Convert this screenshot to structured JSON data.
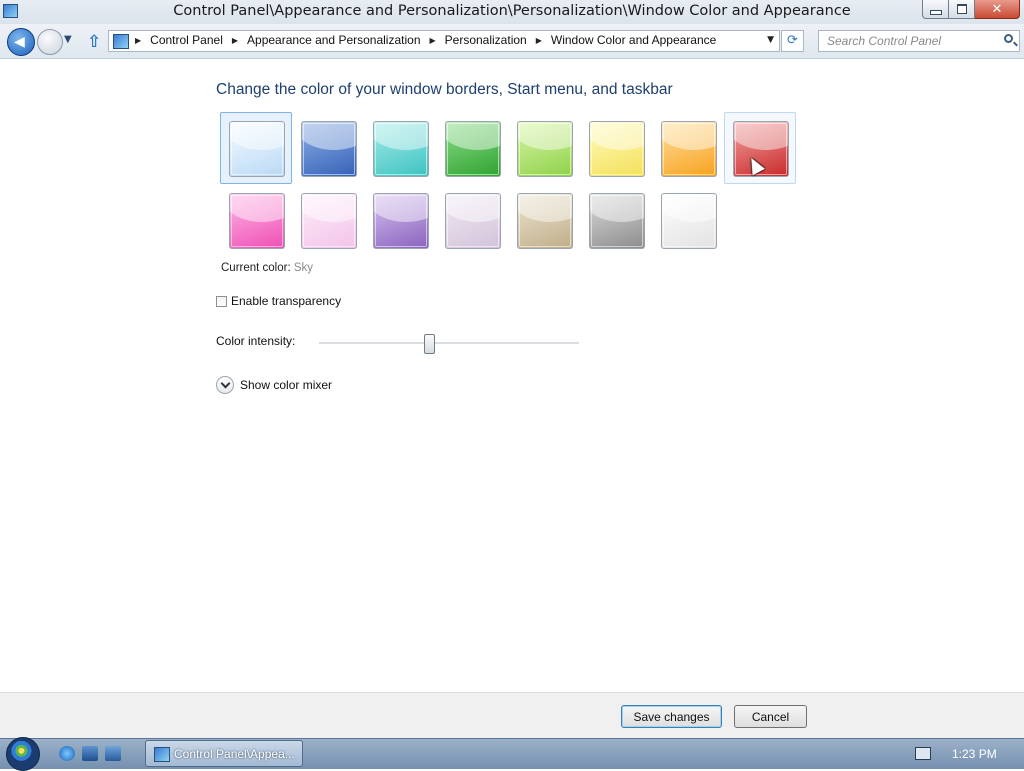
{
  "window": {
    "title": "Control Panel\\Appearance and Personalization\\Personalization\\Window Color and Appearance",
    "controls": {
      "minimize": "minimize",
      "maximize": "restore",
      "close": "close"
    }
  },
  "nav": {
    "breadcrumbs": [
      "Control Panel",
      "Appearance and Personalization",
      "Personalization",
      "Window Color and Appearance"
    ],
    "search_placeholder": "Search Control Panel"
  },
  "content": {
    "heading": "Change the color of your window borders, Start menu, and taskbar",
    "swatches": [
      {
        "name": "sky",
        "colors": [
          "#f6fbff",
          "#b9d9f5"
        ]
      },
      {
        "name": "twilight",
        "colors": [
          "#8fb0e6",
          "#3562b8"
        ]
      },
      {
        "name": "sea",
        "colors": [
          "#a7ece8",
          "#3ec3c2"
        ]
      },
      {
        "name": "leaf",
        "colors": [
          "#8fdc8a",
          "#2ea331"
        ]
      },
      {
        "name": "lime",
        "colors": [
          "#d9f5a6",
          "#8fd24a"
        ]
      },
      {
        "name": "sun",
        "colors": [
          "#fffbbd",
          "#f4e05a"
        ]
      },
      {
        "name": "pumpkin",
        "colors": [
          "#ffe0a0",
          "#f7a21e"
        ]
      },
      {
        "name": "ruby",
        "colors": [
          "#f2a3a3",
          "#c92a2a"
        ]
      },
      {
        "name": "fuchsia",
        "colors": [
          "#ffb8e6",
          "#ee4fb4"
        ]
      },
      {
        "name": "blush",
        "colors": [
          "#fff0fb",
          "#f2c3e8"
        ]
      },
      {
        "name": "violet",
        "colors": [
          "#d6c3ee",
          "#8b62bf"
        ]
      },
      {
        "name": "lavender",
        "colors": [
          "#f1ebf4",
          "#d2c3d9"
        ]
      },
      {
        "name": "taupe",
        "colors": [
          "#ede5d3",
          "#bfae88"
        ]
      },
      {
        "name": "chocolate",
        "colors": [
          "#dcdcdc",
          "#8c8c8c"
        ]
      },
      {
        "name": "frost",
        "colors": [
          "#ffffff",
          "#e2e2e2"
        ]
      }
    ],
    "selected_swatch": "sky",
    "hovered_swatch": "ruby",
    "current_color_label": "Current color:",
    "current_color_value": "Sky",
    "transparency_label": "Enable transparency",
    "transparency_checked": false,
    "intensity_label": "Color intensity:",
    "intensity_value": 0.42,
    "mixer_label": "Show color mixer"
  },
  "footer": {
    "save_label": "Save changes",
    "cancel_label": "Cancel"
  },
  "taskbar": {
    "task_label": "Control Panel\\Appea...",
    "clock": "1:23 PM"
  }
}
